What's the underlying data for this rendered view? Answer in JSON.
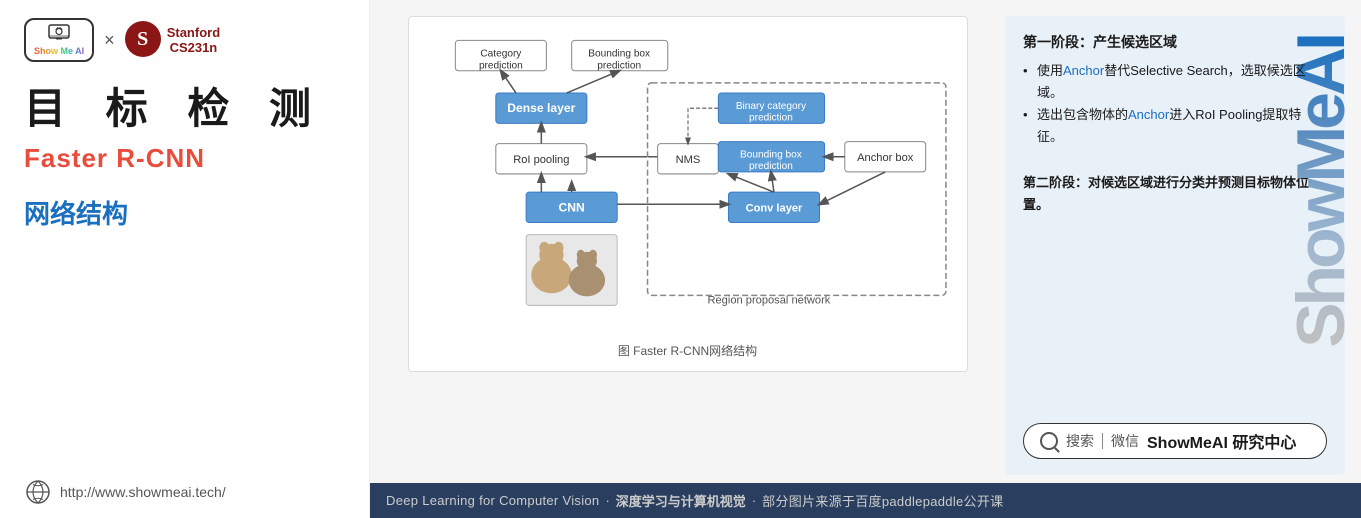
{
  "left": {
    "logo": {
      "showmeai_text": "Show Me AI",
      "x_symbol": "×",
      "stanford_letter": "S",
      "stanford_name": "Stanford",
      "stanford_course": "CS231n"
    },
    "main_title": "目  标  检  测",
    "subtitle": "Faster R-CNN",
    "section_title": "网络结构",
    "website": "http://www.showmeai.tech/"
  },
  "right": {
    "diagram_caption": "图 Faster R-CNN网络结构",
    "description": {
      "phase1_title": "第一阶段：产生候选区域",
      "bullet1": "使用Anchor替代Selective Search，选取候选区域。",
      "bullet1_highlight": "Anchor",
      "bullet2": "选出包含物体的Anchor进入RoI Pooling提取特征。",
      "bullet2_highlight": "Anchor",
      "phase2_title": "第二阶段：对候选区域进行分类并预测目标物体位置。",
      "phase2_highlight": "第二阶段："
    },
    "search": {
      "icon_label": "搜索",
      "divider": "|",
      "label": "微信",
      "brand": "ShowMeAI 研究中心"
    },
    "watermark": "ShowMeAI",
    "bottom": {
      "text1": "Deep Learning for Computer Vision",
      "dot": "·",
      "text2": "深度学习与计算机视觉",
      "dot2": "·",
      "text3": "部分图片来源于百度paddlepaddle公开课"
    }
  }
}
